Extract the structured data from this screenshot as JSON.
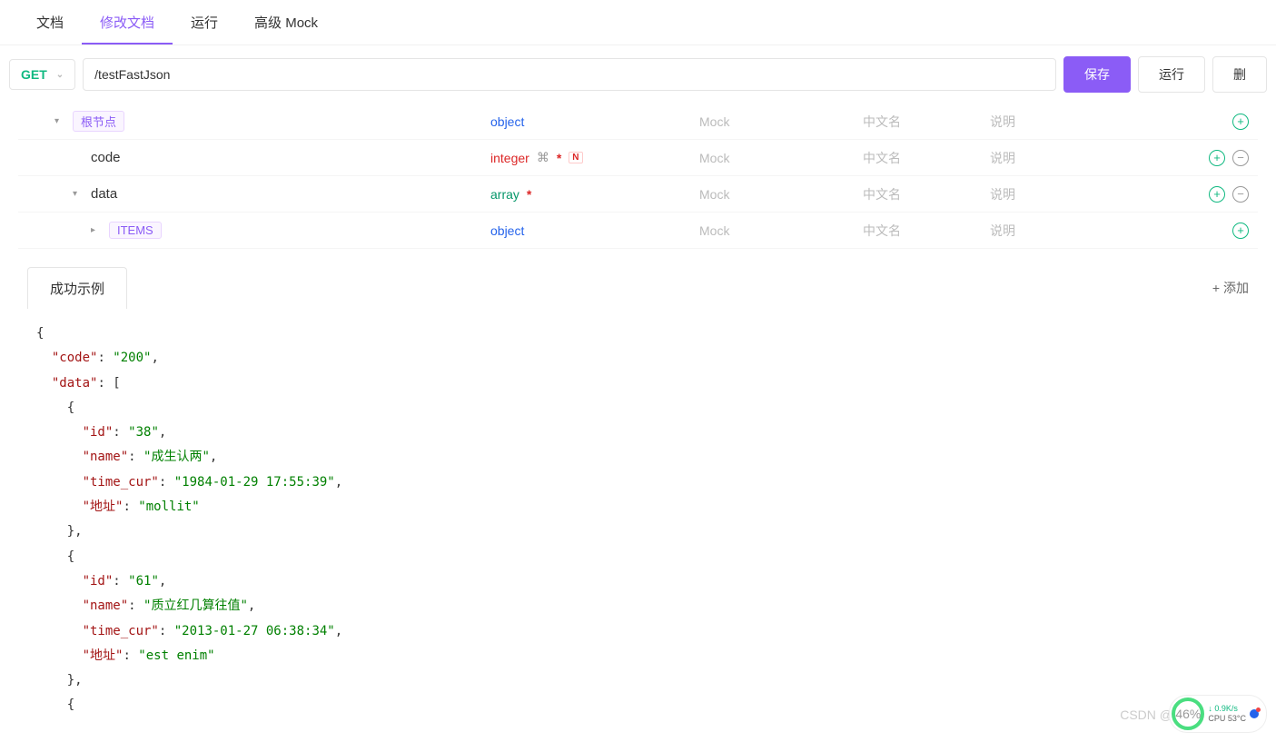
{
  "tabs": {
    "items": [
      {
        "label": "文档",
        "active": false
      },
      {
        "label": "修改文档",
        "active": true
      },
      {
        "label": "运行",
        "active": false
      },
      {
        "label": "高级 Mock",
        "active": false
      }
    ]
  },
  "request": {
    "method": "GET",
    "url": "/testFastJson"
  },
  "actions": {
    "save": "保存",
    "run": "运行",
    "delete": "删"
  },
  "schema": {
    "mock_placeholder": "Mock",
    "cnname_placeholder": "中文名",
    "desc_placeholder": "说明",
    "rows": [
      {
        "level": 1,
        "name": "根节点",
        "kind": "root",
        "type": "object",
        "typeClass": "type-object",
        "expandable": true,
        "expanded": true,
        "hasLink": false,
        "required": false,
        "nBadge": false,
        "canRemove": false
      },
      {
        "level": 2,
        "name": "code",
        "kind": "field",
        "type": "integer",
        "typeClass": "type-integer",
        "expandable": false,
        "expanded": false,
        "hasLink": true,
        "required": true,
        "nBadge": true,
        "canRemove": true
      },
      {
        "level": 2,
        "name": "data",
        "kind": "field",
        "type": "array",
        "typeClass": "type-array",
        "expandable": true,
        "expanded": true,
        "hasLink": false,
        "required": true,
        "nBadge": false,
        "canRemove": true
      },
      {
        "level": 3,
        "name": "ITEMS",
        "kind": "items",
        "type": "object",
        "typeClass": "type-object",
        "expandable": true,
        "expanded": false,
        "hasLink": false,
        "required": false,
        "nBadge": false,
        "canRemove": false
      }
    ]
  },
  "example": {
    "tab_label": "成功示例",
    "add_label": "+ 添加",
    "json": {
      "code": "200",
      "data": [
        {
          "id": "38",
          "name": "成生认两",
          "time_cur": "1984-01-29 17:55:39",
          "地址": "mollit"
        },
        {
          "id": "61",
          "name": "质立红几算往值",
          "time_cur": "2013-01-27 06:38:34",
          "地址": "est enim"
        }
      ]
    }
  },
  "watermark": "CSDN @霸道流氓气质",
  "perf": {
    "percent": "46%",
    "net": "0.9K/s",
    "cpu": "CPU 53°C"
  }
}
